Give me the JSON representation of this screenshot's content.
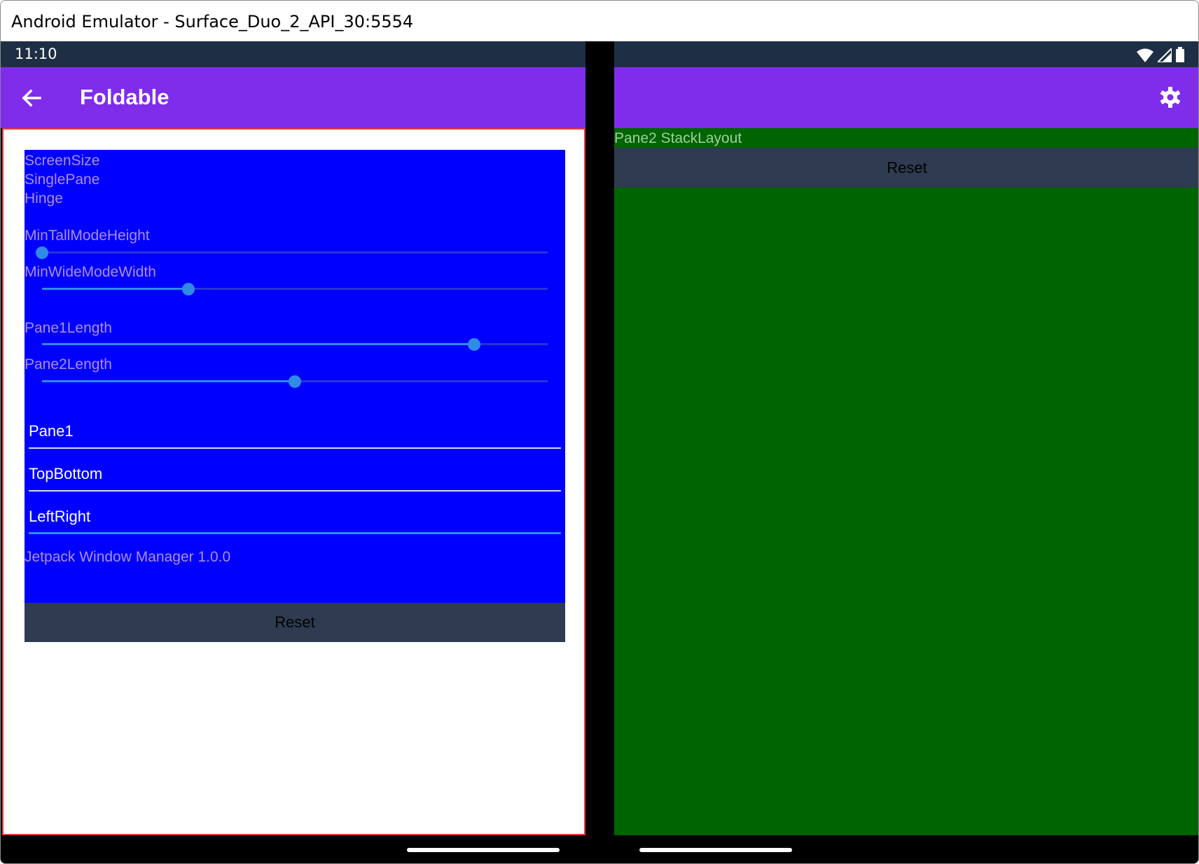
{
  "window": {
    "title": "Android Emulator - Surface_Duo_2_API_30:5554"
  },
  "statusbar": {
    "time": "11:10",
    "icons": [
      "wifi-icon",
      "signal-icon",
      "battery-icon"
    ]
  },
  "appbar": {
    "title": "Foldable",
    "back_icon": "arrow-left-icon",
    "settings_icon": "gear-icon"
  },
  "pane1": {
    "labels": {
      "screen_size": "ScreenSize",
      "single_pane": "SinglePane",
      "hinge": "Hinge"
    },
    "sliders": [
      {
        "label": "MinTallModeHeight",
        "value": 0.0
      },
      {
        "label": "MinWideModeWidth",
        "value": 0.29
      },
      {
        "label": "Pane1Length",
        "value": 0.855
      },
      {
        "label": "Pane2Length",
        "value": 0.5
      }
    ],
    "entries": [
      {
        "value": "Pane1",
        "focused": false
      },
      {
        "value": "TopBottom",
        "focused": false
      },
      {
        "value": "LeftRight",
        "focused": true
      }
    ],
    "version": "Jetpack Window Manager 1.0.0",
    "reset_label": "Reset"
  },
  "pane2": {
    "title": "Pane2 StackLayout",
    "reset_label": "Reset"
  },
  "colors": {
    "appbar": "#7f2ceb",
    "statusbar": "#1e2f45",
    "pane1_box": "#0000fe",
    "pane2_bg": "#006400",
    "slider": "#2f8be6",
    "pane1_border": "#e53935",
    "button": "#2e3b50"
  }
}
